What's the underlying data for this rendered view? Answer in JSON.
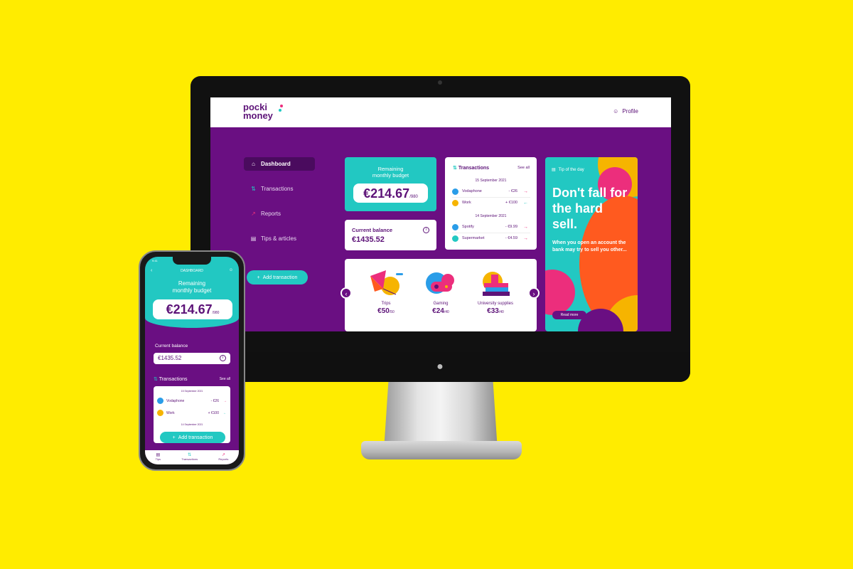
{
  "brand": {
    "line1": "pocki",
    "line2": "money",
    "teal": "#22c8c2",
    "purple": "#6a0f82",
    "pink": "#ec2e7c",
    "yellow": "#ffec00"
  },
  "topbar": {
    "profile_label": "Profile"
  },
  "nav": {
    "items": [
      {
        "label": "Dashboard",
        "icon": "home-icon"
      },
      {
        "label": "Transactions",
        "icon": "swap-icon"
      },
      {
        "label": "Reports",
        "icon": "trend-icon"
      },
      {
        "label": "Tips & articles",
        "icon": "document-icon"
      }
    ],
    "add_transaction": "Add transaction"
  },
  "budget": {
    "title_line1": "Remaining",
    "title_line2": "monthly budget",
    "amount": "€214.67",
    "total": "/980"
  },
  "balance": {
    "title": "Current balance",
    "amount": "€1435.52"
  },
  "transactions": {
    "title": "Transactions",
    "see_all": "See all",
    "groups": [
      {
        "date": "15 September 2021",
        "rows": [
          {
            "name": "Vodaphone",
            "amount": "- €26",
            "color": "#2a9de8"
          },
          {
            "name": "Work",
            "amount": "+ €100",
            "color": "#f6b400"
          }
        ]
      },
      {
        "date": "14 September 2021",
        "rows": [
          {
            "name": "Spotify",
            "amount": "- €9.99",
            "color": "#2a9de8"
          },
          {
            "name": "Supermarket",
            "amount": "- €4.59",
            "color": "#22c8c2"
          }
        ]
      }
    ]
  },
  "goals": [
    {
      "label": "Trips",
      "value": "€50",
      "total": "/50"
    },
    {
      "label": "Gaming",
      "value": "€24",
      "total": "/40"
    },
    {
      "label": "University supplies",
      "value": "€33",
      "total": "/40"
    }
  ],
  "tip": {
    "label": "Tip of the day",
    "title": "Don't fall for the hard sell.",
    "text": "When you open an account the bank may try to sell you other...",
    "button": "Read more"
  },
  "phone": {
    "time": "9:41",
    "header": "DASHBOARD",
    "budget_title_line1": "Remaining",
    "budget_title_line2": "monthly budget",
    "budget_amount": "€214.67",
    "budget_total": "/980",
    "balance_title": "Current balance",
    "balance_amount": "€1435.52",
    "tx_title": "Transactions",
    "tx_see_all": "See all",
    "tx_date1": "15 September 2021",
    "tx_rows": [
      {
        "name": "Vodaphone",
        "amount": "- €26"
      },
      {
        "name": "Work",
        "amount": "+ €100"
      }
    ],
    "tx_date2": "14 September 2021",
    "add_transaction": "Add transaction",
    "tabs": [
      {
        "label": "Tips"
      },
      {
        "label": "Transactions"
      },
      {
        "label": "Reports"
      }
    ]
  }
}
